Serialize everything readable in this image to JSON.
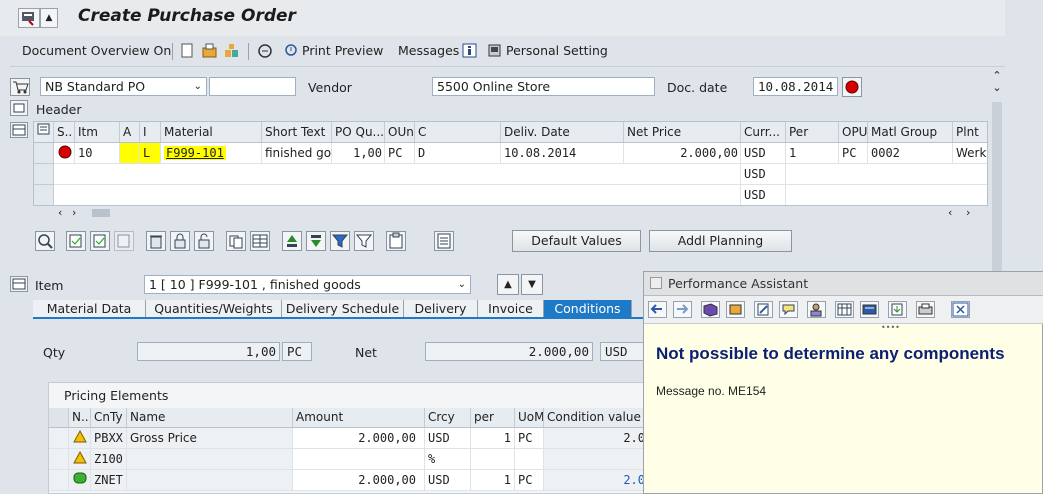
{
  "window": {
    "title": "Create Purchase Order"
  },
  "toolbar": {
    "doc_overview": "Document Overview On",
    "print_preview": "Print Preview",
    "messages": "Messages",
    "personal_setting": "Personal Setting"
  },
  "header": {
    "po_type": "NB Standard PO",
    "vendor_label": "Vendor",
    "vendor_value": "5500 Online Store",
    "doc_date_label": "Doc. date",
    "doc_date_value": "10.08.2014",
    "header_label": "Header"
  },
  "grid": {
    "columns": [
      "S..",
      "Itm",
      "A",
      "I",
      "Material",
      "Short Text",
      "PO Qu...",
      "OUn",
      "C",
      "Deliv. Date",
      "Net Price",
      "Curr...",
      "Per",
      "OPU",
      "Matl Group",
      "Plnt"
    ],
    "row1": {
      "itm": "10",
      "i": "L",
      "material": "F999-101",
      "short_text": "finished go...",
      "qty": "1,00",
      "oun": "PC",
      "c": "D",
      "deliv_date": "10.08.2014",
      "net_price": "2.000,00",
      "curr": "USD",
      "per": "1",
      "opu": "PC",
      "matl_group": "0002",
      "plnt": "Werk"
    },
    "row2_curr": "USD",
    "row3_curr": "USD"
  },
  "buttons": {
    "default_values": "Default Values",
    "addl_planning": "Addl Planning"
  },
  "item": {
    "label": "Item",
    "selected": "1 [ 10 ] F999-101 , finished goods",
    "tabs": [
      "Material Data",
      "Quantities/Weights",
      "Delivery Schedule",
      "Delivery",
      "Invoice",
      "Conditions"
    ],
    "active_tab": "Conditions",
    "qty_label": "Qty",
    "qty_value": "1,00",
    "qty_unit": "PC",
    "net_label": "Net",
    "net_value": "2.000,00",
    "net_curr": "USD"
  },
  "pricing": {
    "title": "Pricing Elements",
    "columns": [
      "N..",
      "CnTy",
      "Name",
      "Amount",
      "Crcy",
      "per",
      "UoM",
      "Condition value"
    ],
    "rows": [
      {
        "cnty": "PBXX",
        "name": "Gross Price",
        "amount": "2.000,00",
        "crcy": "USD",
        "per": "1",
        "uom": "PC",
        "value": "2.0"
      },
      {
        "cnty": "Z100",
        "name": "",
        "amount": "",
        "crcy": "%",
        "per": "",
        "uom": "",
        "value": ""
      },
      {
        "cnty": "ZNET",
        "name": "",
        "amount": "2.000,00",
        "crcy": "USD",
        "per": "1",
        "uom": "PC",
        "value": "2.0"
      }
    ]
  },
  "assistant": {
    "title": "Performance Assistant",
    "heading": "Not possible to determine any components",
    "message": "Message no. ME154"
  },
  "colors": {
    "accent": "#1e7ac6",
    "highlight": "#ffff00",
    "error_red": "#d40000",
    "heading_navy": "#0b1f73"
  }
}
